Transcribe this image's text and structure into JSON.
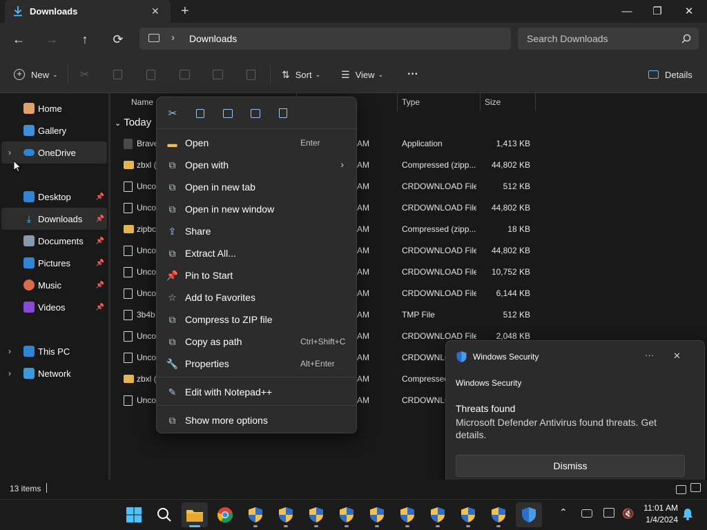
{
  "window": {
    "tab_title": "Downloads",
    "new_tab": "+",
    "minimize": "—",
    "maximize": "❐",
    "close": "✕"
  },
  "address": {
    "back": "←",
    "forward": "→",
    "up": "↑",
    "refresh": "⟳",
    "separator": "›",
    "path": "Downloads",
    "search_placeholder": "Search Downloads"
  },
  "toolbar": {
    "new_label": "New",
    "sort_label": "Sort",
    "view_label": "View",
    "more_label": "···",
    "details_label": "Details"
  },
  "sidebar": {
    "home": "Home",
    "gallery": "Gallery",
    "onedrive": "OneDrive",
    "desktop": "Desktop",
    "downloads": "Downloads",
    "documents": "Documents",
    "pictures": "Pictures",
    "music": "Music",
    "videos": "Videos",
    "thispc": "This PC",
    "network": "Network"
  },
  "columns": {
    "name": "Name",
    "type": "Type",
    "size": "Size"
  },
  "group_label": "Today",
  "files": [
    {
      "name": "Brave",
      "time": "AM",
      "type": "Application",
      "size": "1,413 KB",
      "icon": "app"
    },
    {
      "name": "zbxl (",
      "time": "AM",
      "type": "Compressed (zipp...",
      "size": "44,802 KB",
      "icon": "zip"
    },
    {
      "name": "Unco",
      "time": "AM",
      "type": "CRDOWNLOAD File",
      "size": "512 KB",
      "icon": "doc"
    },
    {
      "name": "Unco",
      "time": "AM",
      "type": "CRDOWNLOAD File",
      "size": "44,802 KB",
      "icon": "doc"
    },
    {
      "name": "zipbc",
      "time": "AM",
      "type": "Compressed (zipp...",
      "size": "18 KB",
      "icon": "zip"
    },
    {
      "name": "Unco",
      "time": "AM",
      "type": "CRDOWNLOAD File",
      "size": "44,802 KB",
      "icon": "doc"
    },
    {
      "name": "Unco",
      "time": "AM",
      "type": "CRDOWNLOAD File",
      "size": "10,752 KB",
      "icon": "doc"
    },
    {
      "name": "Unco",
      "time": "AM",
      "type": "CRDOWNLOAD File",
      "size": "6,144 KB",
      "icon": "doc"
    },
    {
      "name": "3b4b",
      "time": "AM",
      "type": "TMP File",
      "size": "512 KB",
      "icon": "doc"
    },
    {
      "name": "Unco",
      "time": "AM",
      "type": "CRDOWNLOAD File",
      "size": "2,048 KB",
      "icon": "doc"
    },
    {
      "name": "Unco",
      "time": "AM",
      "type": "CRDOWNLC",
      "size": "",
      "icon": "doc"
    },
    {
      "name": "zbxl (",
      "time": "AM",
      "type": "Compressed",
      "size": "",
      "icon": "zip"
    },
    {
      "name": "Unco",
      "time": "AM",
      "type": "CRDOWNLC",
      "size": "",
      "icon": "doc"
    }
  ],
  "context_menu": {
    "items": [
      {
        "label": "Open",
        "shortcut": "Enter"
      },
      {
        "label": "Open with",
        "shortcut": ""
      },
      {
        "label": "Open in new tab",
        "shortcut": ""
      },
      {
        "label": "Open in new window",
        "shortcut": ""
      },
      {
        "label": "Share",
        "shortcut": ""
      },
      {
        "label": "Extract All...",
        "shortcut": ""
      },
      {
        "label": "Pin to Start",
        "shortcut": ""
      },
      {
        "label": "Add to Favorites",
        "shortcut": ""
      },
      {
        "label": "Compress to ZIP file",
        "shortcut": ""
      },
      {
        "label": "Copy as path",
        "shortcut": "Ctrl+Shift+C"
      },
      {
        "label": "Properties",
        "shortcut": "Alt+Enter"
      },
      {
        "label": "Edit with Notepad++",
        "shortcut": ""
      },
      {
        "label": "Show more options",
        "shortcut": ""
      }
    ]
  },
  "toast": {
    "app_name": "Windows Security",
    "more": "···",
    "close": "✕",
    "source": "Windows Security",
    "title": "Threats found",
    "body": "Microsoft Defender Antivirus found threats. Get details.",
    "dismiss": "Dismiss"
  },
  "status": {
    "items_count": "13 items"
  },
  "taskbar": {
    "time": "11:01 AM",
    "date": "1/4/2024"
  },
  "colors": {
    "accent": "#4cc2ff",
    "background": "#191919",
    "panel": "#2c2c2c"
  }
}
